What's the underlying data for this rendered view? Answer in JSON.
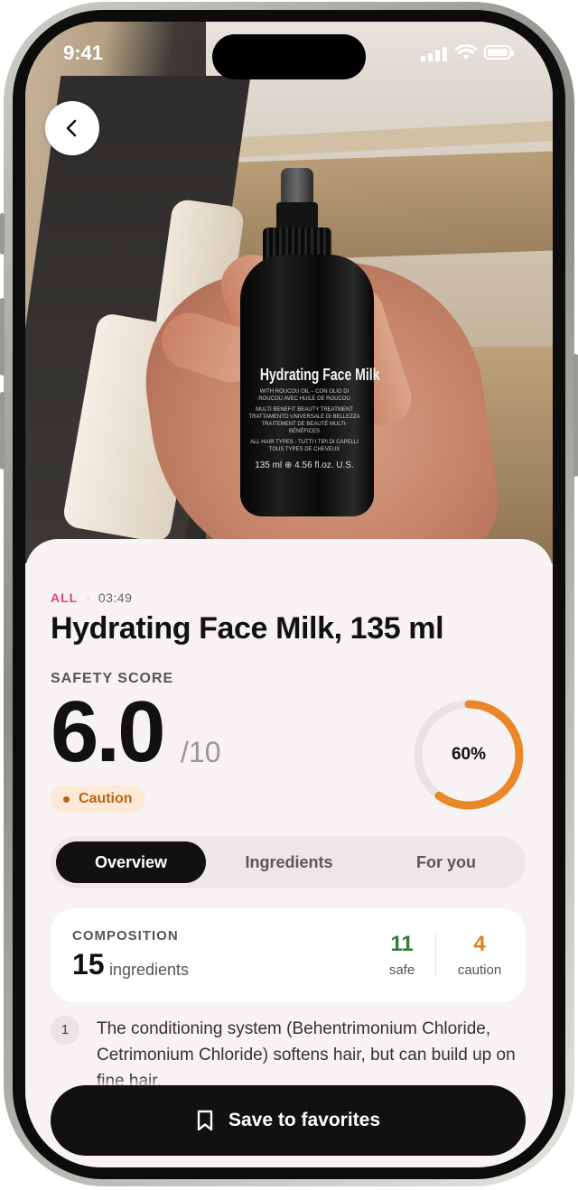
{
  "status_bar": {
    "time": "9:41"
  },
  "product_photo": {
    "bottle_name": "Hydrating Face Milk",
    "bottle_subtext": "WITH ROUCOU OIL – CON OLIO DI ROUCOU AVEC HUILE DE ROUCOU",
    "bottle_subtext2": "MULTI BENEFIT BEAUTY TREATMENT TRATTAMENTO UNIVERSALE DI BELLEZZA TRAITEMENT DE BEAUTÉ MULTI-BÉNÉFICES",
    "bottle_subtext3": "ALL HAIR TYPES - TUTTI I TIPI DI CAPELLI TOUS TYPES DE CHEVEUX",
    "bottle_volume": "135 ml ⊕ 4.56 fl.oz. U.S."
  },
  "header": {
    "category": "ALL",
    "timestamp": "03:49",
    "title": "Hydrating Face Milk, 135 ml"
  },
  "safety": {
    "label": "SAFETY SCORE",
    "score": "6.0",
    "out_of": "/10",
    "badge": "Caution",
    "percent_label": "60%",
    "percent_value": 0.6,
    "ring_color": "#ea8727",
    "track_color": "#e8e3e5"
  },
  "tabs": [
    {
      "label": "Overview",
      "active": true
    },
    {
      "label": "Ingredients",
      "active": false
    },
    {
      "label": "For you",
      "active": false
    }
  ],
  "composition": {
    "label": "COMPOSITION",
    "count": "15",
    "count_word": "ingredients",
    "safe_count": "11",
    "safe_label": "safe",
    "caution_count": "4",
    "caution_label": "caution",
    "safe_color": "#2e7d32",
    "caution_color": "#e0801e"
  },
  "notes": [
    {
      "number": "1",
      "text": "The conditioning system (Behentrimonium Chloride, Cetrimonium Chloride) softens hair, but can build up on fine hair."
    }
  ],
  "actions": {
    "save_label": "Save to favorites"
  }
}
